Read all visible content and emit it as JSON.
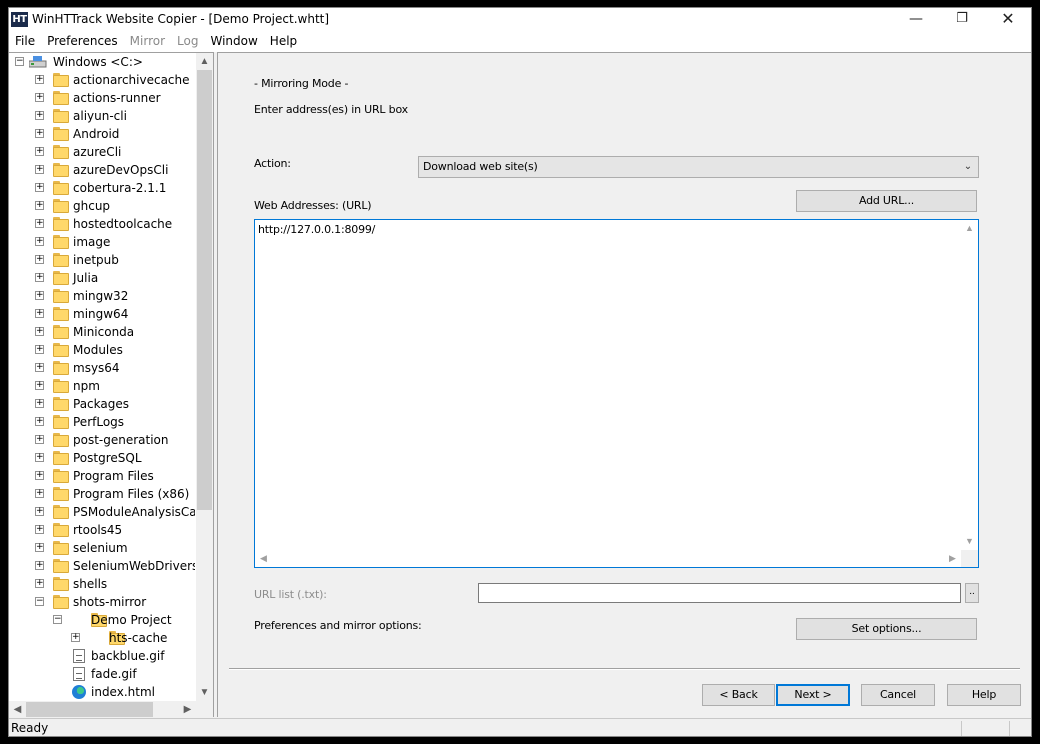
{
  "window": {
    "title": "WinHTTrack Website Copier - [Demo Project.whtt]",
    "app_icon_text": "HT",
    "minimize_glyph": "—",
    "maximize_glyph": "❐",
    "close_glyph": "✕"
  },
  "menu": {
    "items": [
      {
        "label": "File",
        "enabled": true
      },
      {
        "label": "Preferences",
        "enabled": true
      },
      {
        "label": "Mirror",
        "enabled": false
      },
      {
        "label": "Log",
        "enabled": false
      },
      {
        "label": "Window",
        "enabled": true
      },
      {
        "label": "Help",
        "enabled": true
      }
    ]
  },
  "tree": {
    "root": {
      "label": "Windows <C:>",
      "expander": "−",
      "icon": "drive-icon"
    },
    "folders": [
      "actionarchivecache",
      "actions-runner",
      "aliyun-cli",
      "Android",
      "azureCli",
      "azureDevOpsCli",
      "cobertura-2.1.1",
      "ghcup",
      "hostedtoolcache",
      "image",
      "inetpub",
      "Julia",
      "mingw32",
      "mingw64",
      "Miniconda",
      "Modules",
      "msys64",
      "npm",
      "Packages",
      "PerfLogs",
      "post-generation",
      "PostgreSQL",
      "Program Files",
      "Program Files (x86)",
      "PSModuleAnalysisCache",
      "rtools45",
      "selenium",
      "SeleniumWebDrivers",
      "shells",
      "shots-mirror"
    ],
    "expanded": {
      "project": "Demo Project",
      "subfolder": "hts-cache",
      "files": [
        {
          "label": "backblue.gif",
          "icon": "file-icon"
        },
        {
          "label": "fade.gif",
          "icon": "file-icon"
        },
        {
          "label": "index.html",
          "icon": "edge-icon"
        }
      ]
    },
    "expand_plus": "+",
    "expand_minus": "−",
    "scroll_up": "▲",
    "scroll_down": "▼",
    "scroll_left": "◀",
    "scroll_right": "▶"
  },
  "main": {
    "mode_title": "- Mirroring Mode -",
    "instruction": "Enter address(es) in URL box",
    "action_label": "Action:",
    "action_value": "Download web site(s)",
    "action_chevron": "⌄",
    "web_addresses_label": "Web Addresses: (URL)",
    "add_url_button": "Add URL...",
    "url_text": "http://127.0.0.1:8099/",
    "url_list_label": "URL list (.txt):",
    "url_list_value": "",
    "browse_button": "..",
    "prefs_label": "Preferences and mirror options:",
    "set_options_button": "Set options...",
    "back_button": "< Back",
    "next_button": "Next >",
    "cancel_button": "Cancel",
    "help_button": "Help"
  },
  "status": {
    "text": "Ready"
  }
}
